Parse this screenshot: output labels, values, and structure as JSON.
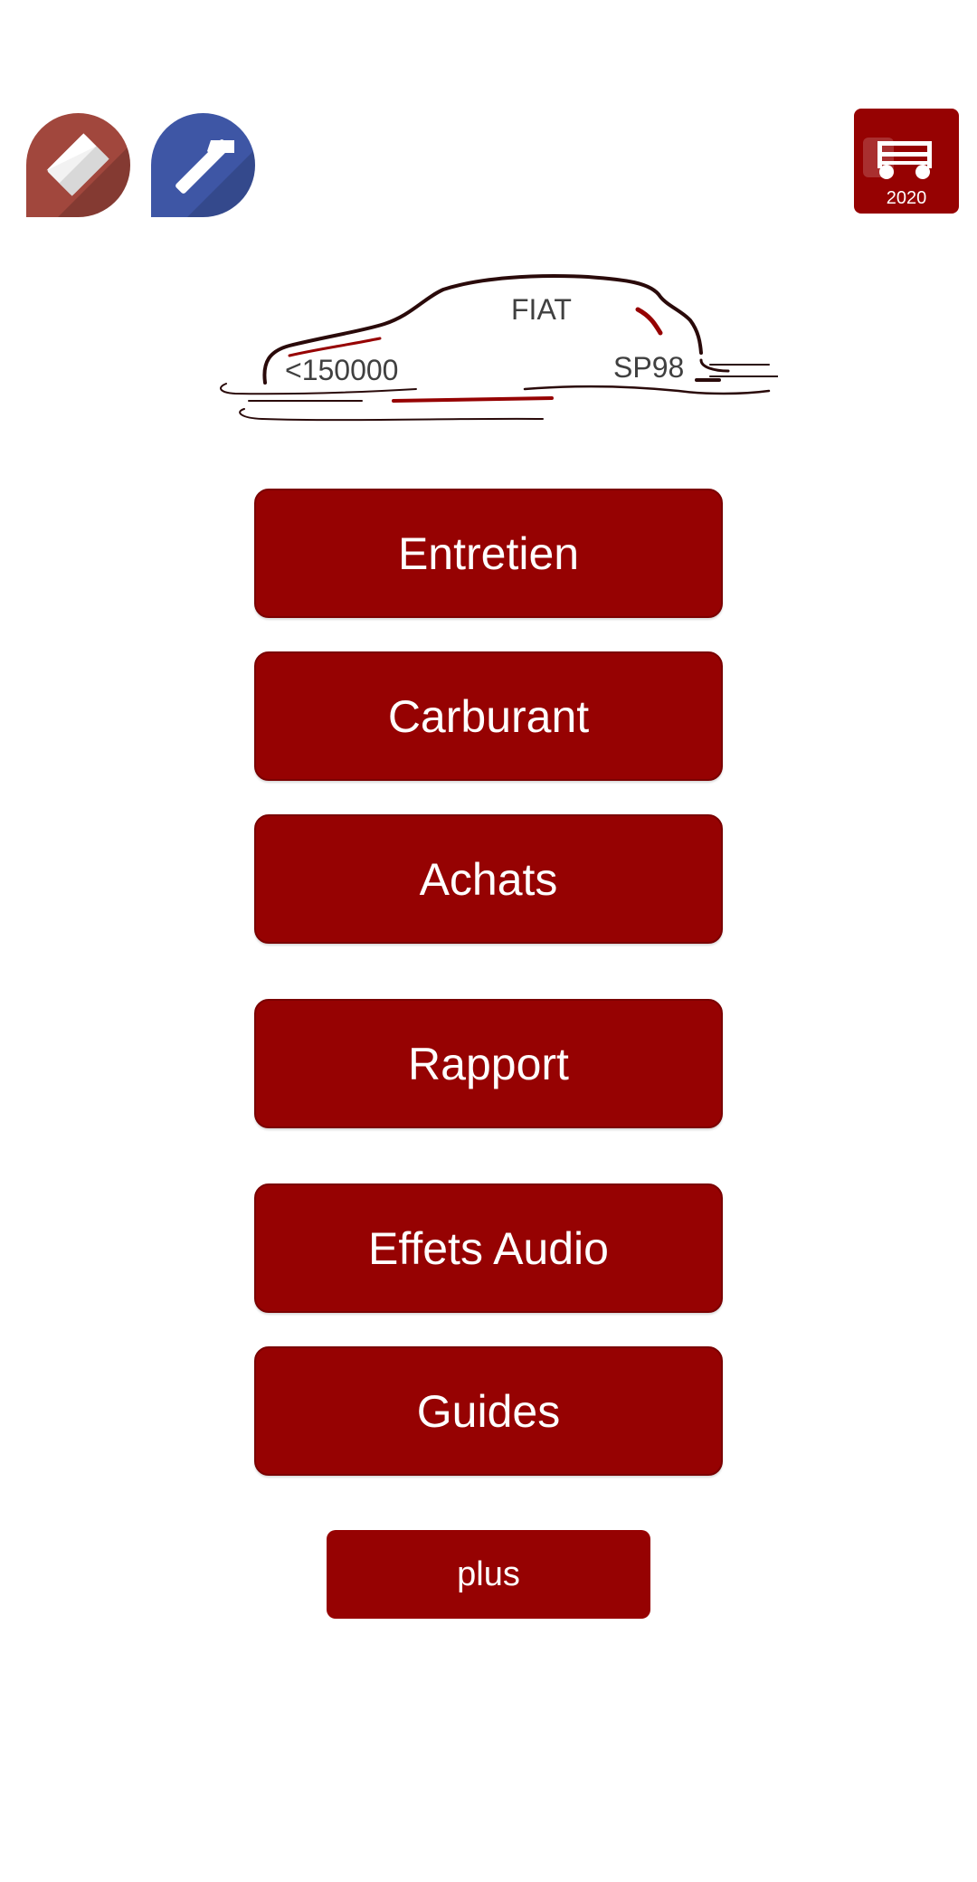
{
  "header": {
    "edit_icon": "pencil-icon",
    "tools_icon": "wrench-icon",
    "vehicle_badge": {
      "icon": "car-icon",
      "year": "2020"
    }
  },
  "vehicle": {
    "brand": "FIAT",
    "mileage": "<150000",
    "fuel": "SP98"
  },
  "menu": {
    "entretien": "Entretien",
    "carburant": "Carburant",
    "achats": "Achats",
    "rapport": "Rapport",
    "effets_audio": "Effets Audio",
    "guides": "Guides",
    "plus": "plus"
  },
  "colors": {
    "accent": "#960202",
    "edit_icon_bg": "#a1473d",
    "tools_icon_bg": "#3e56a5",
    "background": "#ffffff"
  }
}
